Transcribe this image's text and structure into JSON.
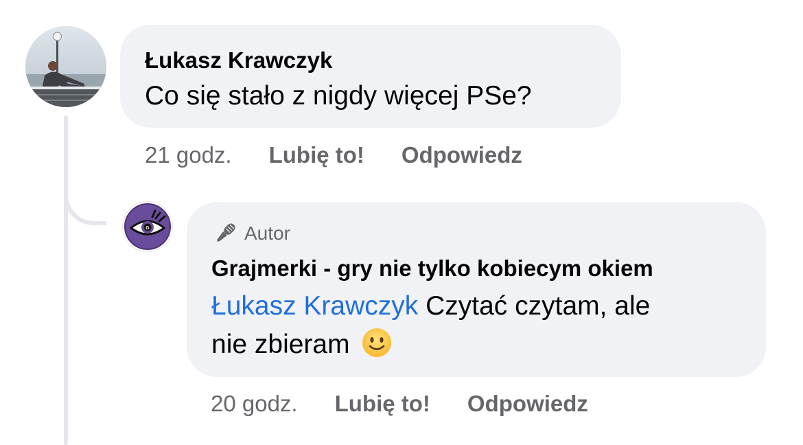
{
  "comment": {
    "author": "Łukasz Krawczyk",
    "text": "Co się stało z nigdy więcej PSe?",
    "time": "21 godz.",
    "like_label": "Lubię to!",
    "reply_label": "Odpowiedz"
  },
  "reply": {
    "badge": "Autor",
    "author": "Grajmerki - gry nie tylko kobiecym okiem",
    "mention": "Łukasz Krawczyk",
    "text_line1": " Czytać czytam, ale",
    "text_line2": "nie zbieram",
    "emoji_icon": "slightly-smiling-face-icon",
    "time": "20 godz.",
    "like_label": "Lubię to!",
    "reply_label": "Odpowiedz"
  },
  "colors": {
    "bubble": "#f0f2f5",
    "meta_text": "#65676b",
    "mention": "#216fdb",
    "thread_line": "#e4e6eb"
  }
}
